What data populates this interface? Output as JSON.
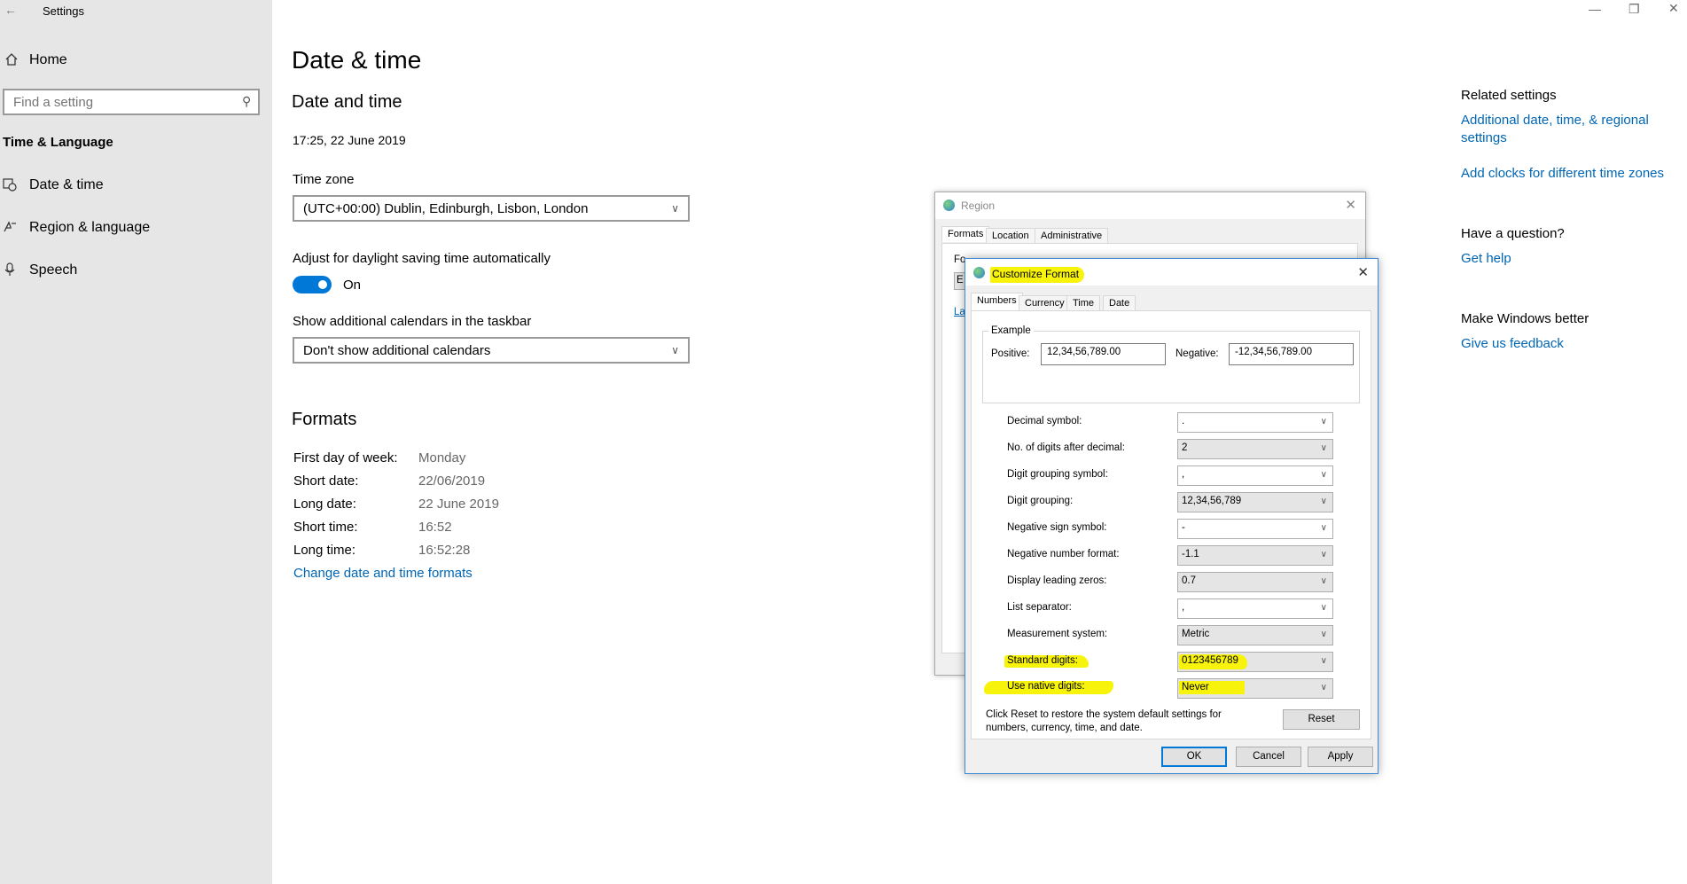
{
  "settings": {
    "app_title": "Settings",
    "home": "Home",
    "search_placeholder": "Find a setting",
    "category": "Time & Language",
    "nav": [
      {
        "label": "Date & time"
      },
      {
        "label": "Region & language"
      },
      {
        "label": "Speech"
      }
    ],
    "page_title": "Date & time",
    "section_title": "Date and time",
    "current_datetime": "17:25, 22 June 2019",
    "timezone_label": "Time zone",
    "timezone_value": "(UTC+00:00) Dublin, Edinburgh, Lisbon, London",
    "dst_label": "Adjust for daylight saving time automatically",
    "dst_state": "On",
    "calendars_label": "Show additional calendars in the taskbar",
    "calendars_value": "Don't show additional calendars",
    "formats_title": "Formats",
    "formats": [
      {
        "label": "First day of week:",
        "value": "Monday"
      },
      {
        "label": "Short date:",
        "value": "22/06/2019"
      },
      {
        "label": "Long date:",
        "value": "22 June 2019"
      },
      {
        "label": "Short time:",
        "value": "16:52"
      },
      {
        "label": "Long time:",
        "value": "16:52:28"
      }
    ],
    "change_formats_link": "Change date and time formats",
    "related_title": "Related settings",
    "related_link1": "Additional date, time, & regional settings",
    "related_link2": "Add clocks for different time zones",
    "question_title": "Have a question?",
    "get_help": "Get help",
    "better_title": "Make Windows better",
    "feedback": "Give us feedback"
  },
  "region_dialog": {
    "title": "Region",
    "tabs": [
      "Formats",
      "Location",
      "Administrative"
    ],
    "frag_fo": "Fo",
    "frag_e": "E",
    "frag_la": "La"
  },
  "customize_dialog": {
    "title": "Customize Format",
    "tabs": [
      "Numbers",
      "Currency",
      "Time",
      "Date"
    ],
    "example_label": "Example",
    "positive_label": "Positive:",
    "positive_value": "12,34,56,789.00",
    "negative_label": "Negative:",
    "negative_value": "-12,34,56,789.00",
    "rows": [
      {
        "label": "Decimal symbol:",
        "value": "."
      },
      {
        "label": "No. of digits after decimal:",
        "value": "2"
      },
      {
        "label": "Digit grouping symbol:",
        "value": ","
      },
      {
        "label": "Digit grouping:",
        "value": "12,34,56,789"
      },
      {
        "label": "Negative sign symbol:",
        "value": "-"
      },
      {
        "label": "Negative number format:",
        "value": "-1.1"
      },
      {
        "label": "Display leading zeros:",
        "value": "0.7"
      },
      {
        "label": "List separator:",
        "value": ","
      },
      {
        "label": "Measurement system:",
        "value": "Metric"
      },
      {
        "label": "Standard digits:",
        "value": "0123456789"
      },
      {
        "label": "Use native digits:",
        "value": "Never"
      }
    ],
    "reset_text": "Click Reset to restore the system default settings for numbers, currency, time, and date.",
    "reset_btn": "Reset",
    "ok_btn": "OK",
    "cancel_btn": "Cancel",
    "apply_btn": "Apply"
  },
  "colors": {
    "accent": "#0078d7",
    "link": "#0066b4",
    "highlight": "#f7f30a",
    "sidebar_bg": "#e6e6e6"
  }
}
